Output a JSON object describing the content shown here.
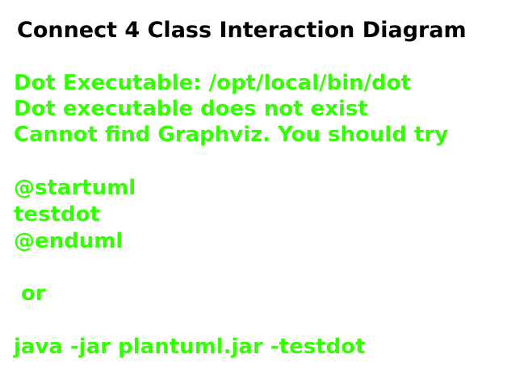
{
  "diagram": {
    "title": "Connect 4 Class Interaction Diagram",
    "message_color": "#33FF02",
    "lines": [
      "Dot Executable: /opt/local/bin/dot",
      "Dot executable does not exist",
      "Cannot find Graphviz. You should try",
      "@startuml",
      "testdot",
      "@enduml",
      " or",
      "java -jar plantuml.jar -testdot"
    ]
  }
}
